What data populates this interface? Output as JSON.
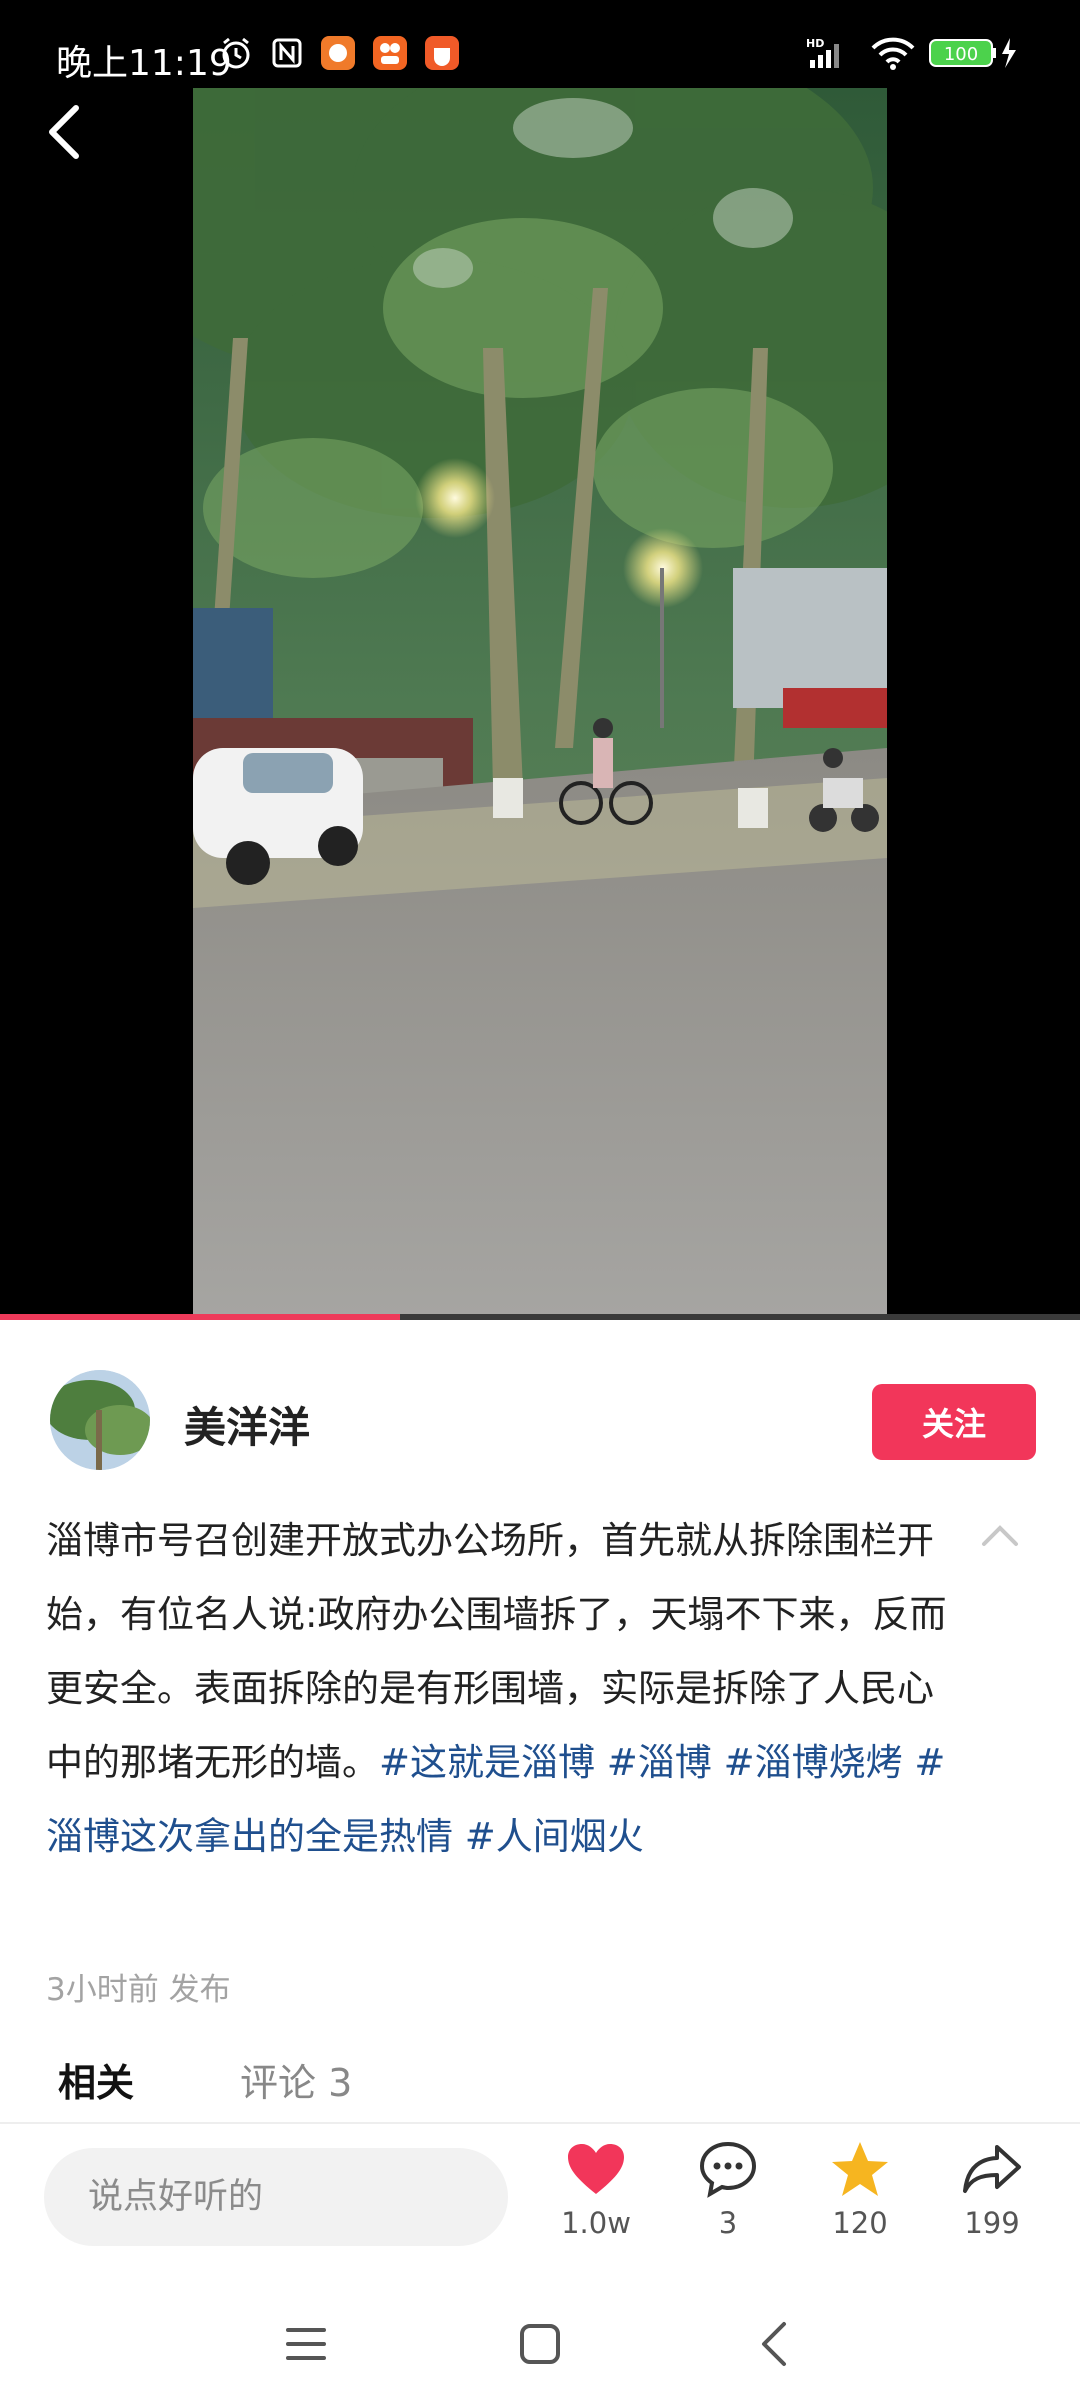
{
  "status_bar": {
    "time": "晚上11:19",
    "network": "HD",
    "battery": "100"
  },
  "video": {
    "progress_fraction": 0.37
  },
  "post": {
    "author": "美洋洋",
    "follow_label": "关注",
    "caption_text": "淄博市号召创建开放式办公场所，首先就从拆除围栏开始，有位名人说:政府办公围墙拆了，天塌不下来，反而更安全。表面拆除的是有形围墙，实际是拆除了人民心中的那堵无形的墙。",
    "hashtags": [
      "#这就是淄博",
      "#淄博",
      "#淄博烧烤",
      "#淄博这次拿出的全是热情",
      "#人间烟火"
    ],
    "time_posted": "3小时前 发布"
  },
  "tabs": {
    "related": "相关",
    "comments": "评论 3"
  },
  "action_bar": {
    "input_placeholder": "说点好听的",
    "likes": "1.0w",
    "comments": "3",
    "favorites": "120",
    "shares": "199"
  },
  "colors": {
    "accent": "#f2365a",
    "hashtag": "#1f4f8e",
    "star": "#f6b520"
  },
  "icons": [
    "alarm-icon",
    "nfc-icon",
    "app-icon",
    "signal-icon",
    "wifi-icon",
    "battery-icon",
    "back-icon",
    "collapse-icon",
    "heart-icon",
    "comment-icon",
    "star-icon",
    "share-icon",
    "menu-nav-icon",
    "home-nav-icon",
    "back-nav-icon"
  ]
}
